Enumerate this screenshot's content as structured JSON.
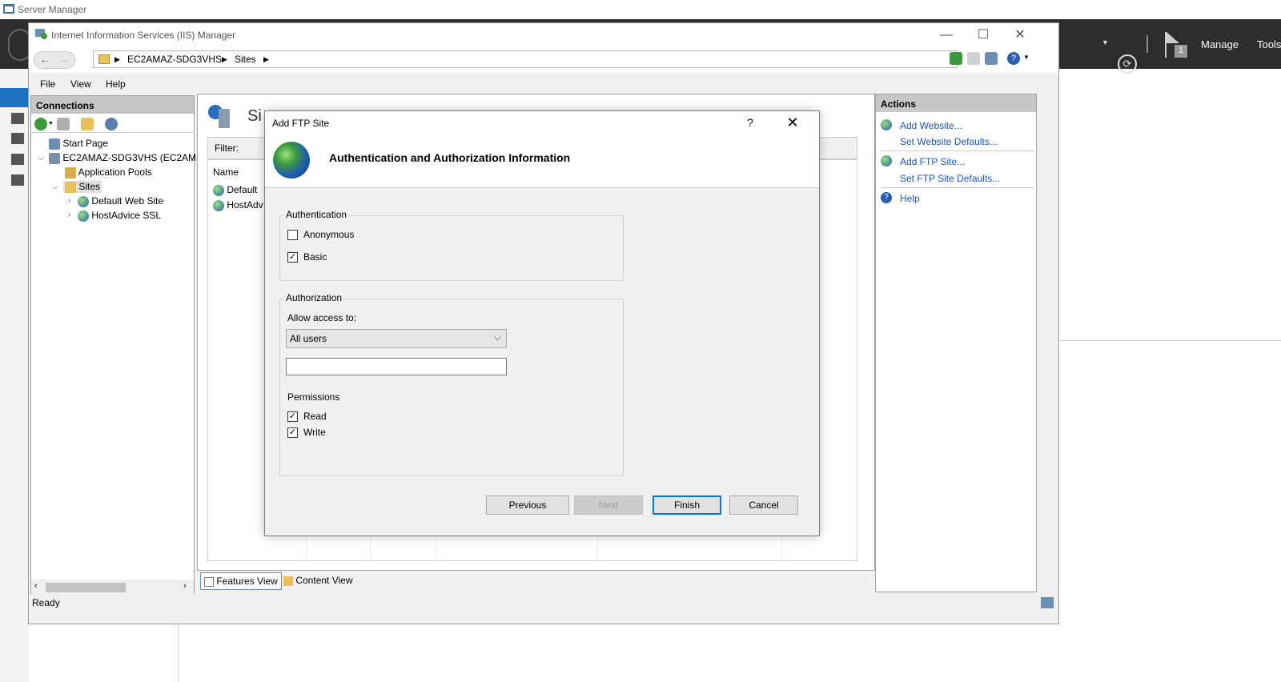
{
  "server_manager": {
    "title": "Server Manager",
    "menu_manage": "Manage",
    "menu_tools": "Tools",
    "flag_count": "1"
  },
  "iis": {
    "title": "Internet Information Services (IIS) Manager",
    "breadcrumb": [
      "EC2AMAZ-SDG3VHS",
      "Sites"
    ],
    "menu": [
      "File",
      "View",
      "Help"
    ],
    "connections": {
      "header": "Connections",
      "tree": {
        "start_page": "Start Page",
        "server": "EC2AMAZ-SDG3VHS (EC2AM",
        "app_pools": "Application Pools",
        "sites": "Sites",
        "site1": "Default Web Site",
        "site2": "HostAdvice SSL"
      }
    },
    "center": {
      "title": "Si",
      "filter_label": "Filter:",
      "col_name": "Name",
      "rows": [
        "Default",
        "HostAdv"
      ]
    },
    "view_tabs": {
      "features": "Features View",
      "content": "Content View"
    },
    "actions": {
      "header": "Actions",
      "add_website": "Add Website...",
      "set_website_defaults": "Set Website Defaults...",
      "add_ftp_site": "Add FTP Site...",
      "set_ftp_defaults": "Set FTP Site Defaults...",
      "help": "Help"
    },
    "status": "Ready"
  },
  "dialog": {
    "title": "Add FTP Site",
    "help_glyph": "?",
    "heading": "Authentication and Authorization Information",
    "authentication": {
      "label": "Authentication",
      "anonymous": "Anonymous",
      "basic": "Basic",
      "anonymous_checked": false,
      "basic_checked": true
    },
    "authorization": {
      "label": "Authorization",
      "allow_access_label": "Allow access to:",
      "allow_access_value": "All users",
      "user_field_value": ""
    },
    "permissions": {
      "label": "Permissions",
      "read": "Read",
      "write": "Write",
      "read_checked": true,
      "write_checked": true
    },
    "buttons": {
      "previous": "Previous",
      "next": "Next",
      "finish": "Finish",
      "cancel": "Cancel"
    }
  },
  "colors": {
    "accent": "#0078d7",
    "link": "#1a56b8",
    "sm_header": "#2d2d2d"
  }
}
